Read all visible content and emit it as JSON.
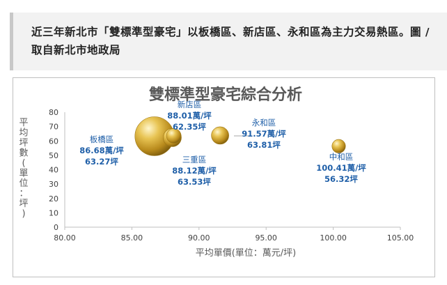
{
  "caption": "近三年新北市「雙標準型豪宅」以板橋區、新店區、永和區為主力交易熱區。圖 / 取自新北市地政局",
  "chart_data": {
    "type": "bubble",
    "title": "雙標準型豪宅綜合分析",
    "xlabel": "平均單價(單位：萬元/坪)",
    "ylabel": "平均坪數(單位：坪)",
    "xlim": [
      80,
      105
    ],
    "ylim": [
      0,
      80
    ],
    "x_ticks": [
      "80.00",
      "85.00",
      "90.00",
      "95.00",
      "100.00",
      "105.00"
    ],
    "y_ticks": [
      "0",
      "10",
      "20",
      "30",
      "40",
      "50",
      "60",
      "70",
      "80"
    ],
    "grid": false,
    "points": [
      {
        "name": "板橋區",
        "x": 86.68,
        "y": 63.27,
        "size": 100,
        "label_price": "86.68萬/坪",
        "label_area": "63.27坪"
      },
      {
        "name": "新店區",
        "x": 88.01,
        "y": 62.35,
        "size": 22,
        "label_price": "88.01萬/坪",
        "label_area": "62.35坪"
      },
      {
        "name": "三重區",
        "x": 88.12,
        "y": 63.53,
        "size": 14,
        "label_price": "88.12萬/坪",
        "label_area": "63.53坪"
      },
      {
        "name": "永和區",
        "x": 91.57,
        "y": 63.81,
        "size": 20,
        "label_price": "91.57萬/坪",
        "label_area": "63.81坪"
      },
      {
        "name": "中和區",
        "x": 100.41,
        "y": 56.32,
        "size": 12,
        "label_price": "100.41萬/坪",
        "label_area": "56.32坪"
      }
    ]
  }
}
